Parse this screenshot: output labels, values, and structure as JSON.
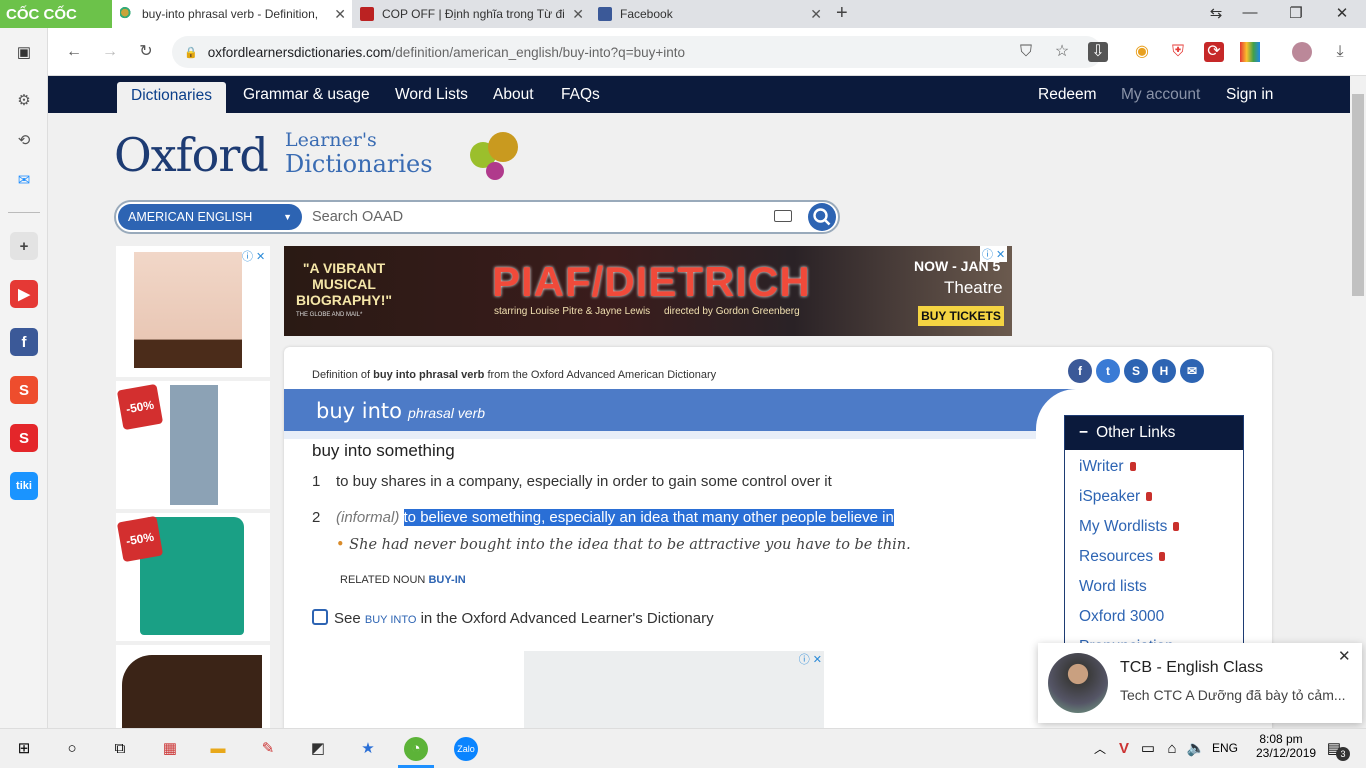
{
  "browser": {
    "brand": "CỐC CỐC",
    "tabs": [
      {
        "title": "buy-into phrasal verb - Definition, pictures, pronunciation and usage notes",
        "active": true
      },
      {
        "title": "COP OFF | Định nghĩa trong Từ điển tiếng Anh Cambridge",
        "active": false
      },
      {
        "title": "Facebook",
        "active": false
      }
    ],
    "new_tab": "+",
    "url_domain": "oxfordlearnersdictionaries.com",
    "url_path": "/definition/american_english/buy-into?q=buy+into"
  },
  "site": {
    "nav": {
      "dictionaries": "Dictionaries",
      "grammar": "Grammar & usage",
      "wordlists": "Word Lists",
      "about": "About",
      "faqs": "FAQs",
      "redeem": "Redeem",
      "account": "My account",
      "signin": "Sign in"
    },
    "logo_main": "Oxford",
    "logo_sub1": "Learner's",
    "logo_sub2": "Dictionaries",
    "dictionary_select": "AMERICAN ENGLISH",
    "search_placeholder": "Search OAAD"
  },
  "ads": {
    "banner_quote": "\"A VIBRANT MUSICAL BIOGRAPHY!\"",
    "banner_quote_source": "THE GLOBE AND MAIL*",
    "banner_title": "PIAF/DIETRICH",
    "banner_starring": "starring Louise Pitre & Jayne Lewis",
    "banner_director": "directed by Gordon Greenberg",
    "banner_dates": "NOW - JAN 5",
    "banner_venue": "Theatre",
    "banner_cta": "BUY TICKETS",
    "discount_1": "-50%",
    "discount_2": "-50%"
  },
  "entry": {
    "definition_of_pre": "Definition of ",
    "definition_of_word": "buy into phrasal verb",
    "definition_of_post": " from the Oxford Advanced American Dictionary",
    "headword": "buy into",
    "pos": "phrasal verb",
    "idiom": "buy into something",
    "senses": [
      {
        "num": "1",
        "label": "",
        "text": "to buy shares in a company, especially in order to gain some control over it"
      },
      {
        "num": "2",
        "label": "(informal)",
        "text": "to believe something, especially an idea that many other people believe in"
      }
    ],
    "example": "She had never bought into the idea that to be attractive you have to be thin.",
    "related_label": "RELATED NOUN",
    "related_word": "BUY-IN",
    "see_pre": "See ",
    "see_word": "BUY INTO",
    "see_post": " in the Oxford Advanced Learner's Dictionary"
  },
  "other_links": {
    "title": "Other Links",
    "items": [
      "iWriter",
      "iSpeaker",
      "My Wordlists",
      "Resources",
      "Word lists",
      "Oxford 3000",
      "Pronunciation"
    ]
  },
  "notification": {
    "title": "TCB - English Class",
    "text": "Tech CTC A Dưỡng đã bày tỏ cảm..."
  },
  "taskbar": {
    "lang": "ENG",
    "time": "8:08 pm",
    "date": "23/12/2019",
    "badge": "3"
  },
  "colors": {
    "navy": "#0b1a3c",
    "blue": "#2d64b3",
    "headword_bar": "#4d7bc7",
    "highlight": "#2a6fd6"
  }
}
